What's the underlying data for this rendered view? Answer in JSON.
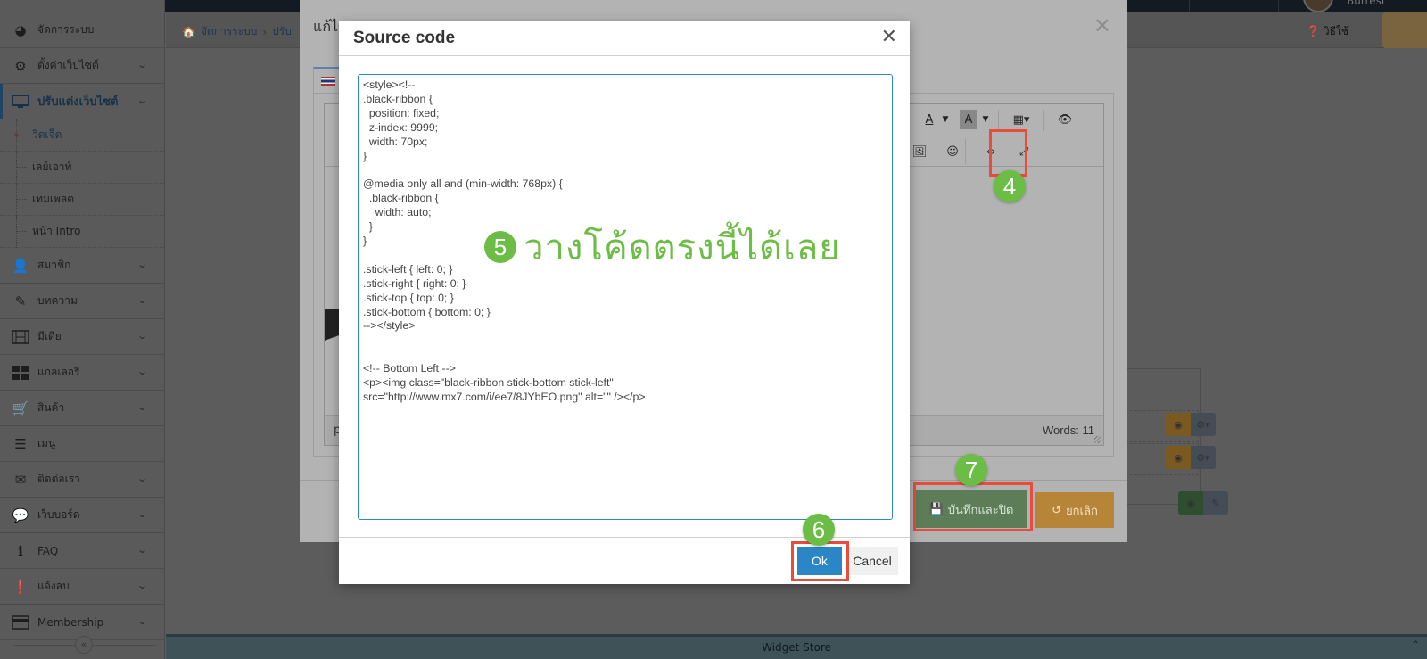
{
  "topbar": {
    "user_name": "Burrest"
  },
  "sidebar": {
    "items": [
      {
        "label": "จัดการระบบ",
        "icon": "dashboard-icon",
        "has_chevron": false
      },
      {
        "label": "ตั้งค่าเว็บไซต์",
        "icon": "gear-icon",
        "has_chevron": true
      },
      {
        "label": "ปรับแต่งเว็บไซต์",
        "icon": "monitor-icon",
        "has_chevron": true,
        "active": true
      },
      {
        "label": "สมาชิก",
        "icon": "user-icon",
        "has_chevron": true
      },
      {
        "label": "บทความ",
        "icon": "edit-icon",
        "has_chevron": true
      },
      {
        "label": "มีเดีย",
        "icon": "film-icon",
        "has_chevron": true
      },
      {
        "label": "แกลเลอรี",
        "icon": "grid-icon",
        "has_chevron": true
      },
      {
        "label": "สินค้า",
        "icon": "cart-icon",
        "has_chevron": true
      },
      {
        "label": "เมนู",
        "icon": "menu-icon",
        "has_chevron": false
      },
      {
        "label": "ติดต่อเรา",
        "icon": "envelope-icon",
        "has_chevron": true
      },
      {
        "label": "เว็บบอร์ด",
        "icon": "comments-icon",
        "has_chevron": true
      },
      {
        "label": "FAQ",
        "icon": "info-icon",
        "has_chevron": true
      },
      {
        "label": "แจ้งลบ",
        "icon": "exclamation-icon",
        "has_chevron": true
      },
      {
        "label": "Membership",
        "icon": "credit-card-icon",
        "has_chevron": true
      }
    ],
    "subitems": [
      {
        "label": "วิดเจ็ด",
        "active": true
      },
      {
        "label": "เลย์เอาท์"
      },
      {
        "label": "เทมเพลต"
      },
      {
        "label": "หน้า Intro"
      }
    ]
  },
  "header": {
    "breadcrumb": [
      "จัดการระบบ",
      "ปรับ"
    ],
    "help_label": "วิธีใช้"
  },
  "edit_modal": {
    "title": "แก้ไข Footer",
    "status_path": "p",
    "words_label": "Words: 11",
    "save_close_label": "บันทึกและปิด",
    "cancel_label": "ยกเลิก"
  },
  "source_dialog": {
    "title": "Source code",
    "code": "<style><!--\n.black-ribbon {\n  position: fixed;\n  z-index: 9999;\n  width: 70px;\n}\n\n@media only all and (min-width: 768px) {\n  .black-ribbon {\n    width: auto;\n  }\n}\n\n.stick-left { left: 0; }\n.stick-right { right: 0; }\n.stick-top { top: 0; }\n.stick-bottom { bottom: 0; }\n--></style>\n\n\n<!-- Bottom Left -->\n<p><img class=\"black-ribbon stick-bottom stick-left\"\nsrc=\"http://www.mx7.com/i/ee7/8JYbEO.png\" alt=\"\" /></p>",
    "ok_label": "Ok",
    "cancel_label": "Cancel"
  },
  "annotations": {
    "step4": "4",
    "step5": "5",
    "step5_text": "วางโค้ดตรงนี้ได้เลย",
    "step6": "6",
    "step7": "7",
    "accent_green": "#6cbd45",
    "highlight_red": "#e74c3c"
  },
  "footer": {
    "label": "Widget Store"
  }
}
